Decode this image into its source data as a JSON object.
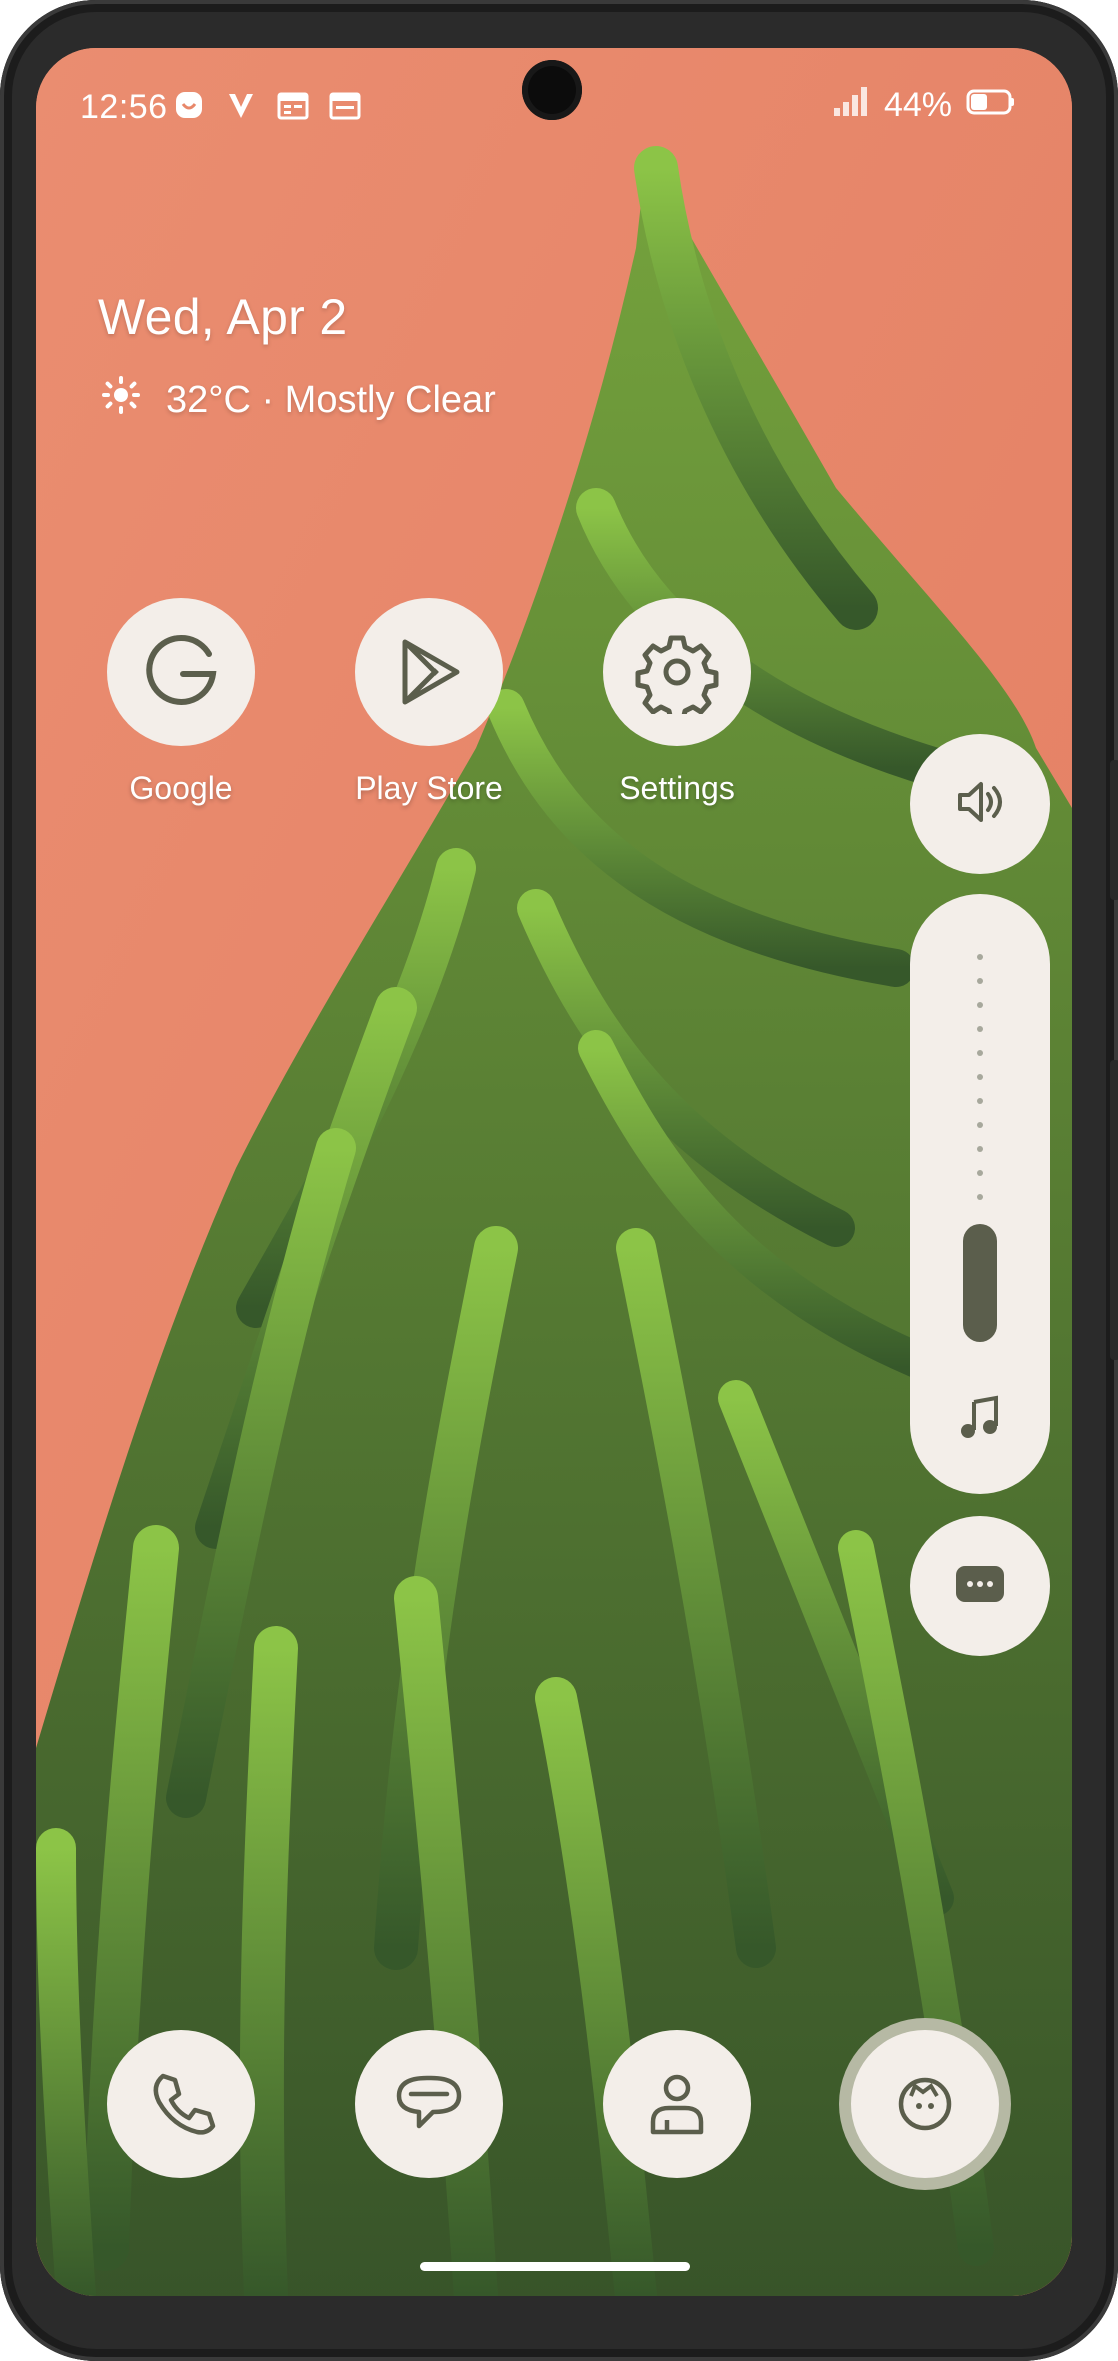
{
  "status_bar": {
    "time": "12:56",
    "left_icons": [
      "smiley-notification-icon",
      "v-notification-icon",
      "calendar-icon",
      "calendar-icon"
    ],
    "battery_percent": "44%",
    "signal_icon": "cellular-signal-icon",
    "battery_icon": "battery-icon"
  },
  "glance": {
    "date": "Wed, Apr 2",
    "weather": "32°C · Mostly Clear",
    "weather_icon": "clear-night-icon"
  },
  "apps": [
    {
      "label": "Google",
      "icon": "google-icon"
    },
    {
      "label": "Play Store",
      "icon": "play-store-icon"
    },
    {
      "label": "Settings",
      "icon": "gear-icon"
    }
  ],
  "dock": [
    {
      "name": "phone",
      "icon": "phone-icon"
    },
    {
      "name": "messages",
      "icon": "chat-bubble-icon"
    },
    {
      "name": "contacts",
      "icon": "person-icon"
    },
    {
      "name": "camera",
      "icon": "cat-camera-icon"
    }
  ],
  "volume_panel": {
    "level": 0.12,
    "stream": "media",
    "top_icon": "speaker-icon",
    "stream_icon": "music-note-icon",
    "more_icon": "more-options-icon"
  },
  "colors": {
    "wallpaper": "#e8876a",
    "icon_bg": "#f3eee9",
    "icon_fg": "#5b5e4c",
    "active_ring": "#b6b9a4"
  }
}
